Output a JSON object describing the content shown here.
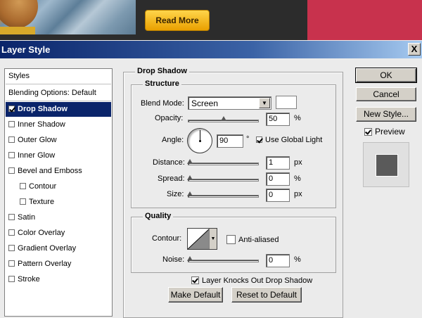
{
  "banner": {
    "read_more": "Read More"
  },
  "window": {
    "title": "Layer Style",
    "close": "X"
  },
  "styles_list": {
    "header": "Styles",
    "blending_options": "Blending Options: Default",
    "items": [
      {
        "label": "Drop Shadow",
        "checked": true,
        "selected": true
      },
      {
        "label": "Inner Shadow",
        "checked": false
      },
      {
        "label": "Outer Glow",
        "checked": false
      },
      {
        "label": "Inner Glow",
        "checked": false
      },
      {
        "label": "Bevel and Emboss",
        "checked": false
      },
      {
        "label": "Contour",
        "checked": false,
        "indent": true
      },
      {
        "label": "Texture",
        "checked": false,
        "indent": true
      },
      {
        "label": "Satin",
        "checked": false
      },
      {
        "label": "Color Overlay",
        "checked": false
      },
      {
        "label": "Gradient Overlay",
        "checked": false
      },
      {
        "label": "Pattern Overlay",
        "checked": false
      },
      {
        "label": "Stroke",
        "checked": false
      }
    ]
  },
  "drop_shadow": {
    "title": "Drop Shadow",
    "structure": {
      "title": "Structure",
      "blend_mode_label": "Blend Mode:",
      "blend_mode_value": "Screen",
      "shadow_color": "#ffffff",
      "opacity_label": "Opacity:",
      "opacity_value": "50",
      "opacity_fraction": 0.5,
      "opacity_unit": "%",
      "angle_label": "Angle:",
      "angle_value": "90",
      "angle_unit": "°",
      "use_global_light_label": "Use Global Light",
      "use_global_light_checked": true,
      "distance_label": "Distance:",
      "distance_value": "1",
      "distance_unit": "px",
      "spread_label": "Spread:",
      "spread_value": "0",
      "spread_unit": "%",
      "size_label": "Size:",
      "size_value": "0",
      "size_unit": "px"
    },
    "quality": {
      "title": "Quality",
      "contour_label": "Contour:",
      "anti_aliased_label": "Anti-aliased",
      "anti_aliased_checked": false,
      "noise_label": "Noise:",
      "noise_value": "0",
      "noise_unit": "%"
    },
    "layer_knocks_out_label": "Layer Knocks Out Drop Shadow",
    "layer_knocks_out_checked": true,
    "make_default": "Make Default",
    "reset_to_default": "Reset to Default"
  },
  "buttons": {
    "ok": "OK",
    "cancel": "Cancel",
    "new_style": "New Style...",
    "preview_label": "Preview",
    "preview_checked": true
  }
}
